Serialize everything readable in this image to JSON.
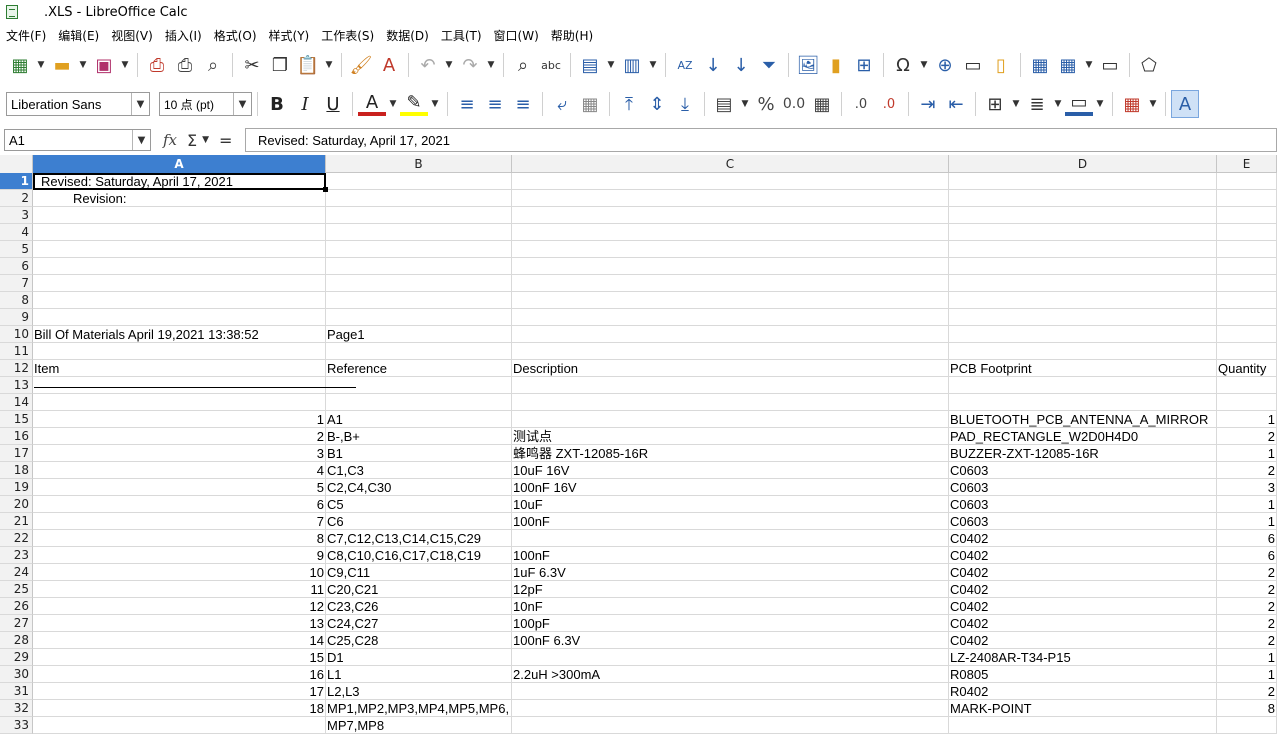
{
  "window": {
    "title": ".XLS - LibreOffice Calc"
  },
  "menu": [
    "文件(F)",
    "编辑(E)",
    "视图(V)",
    "插入(I)",
    "格式(O)",
    "样式(Y)",
    "工作表(S)",
    "数据(D)",
    "工具(T)",
    "窗口(W)",
    "帮助(H)"
  ],
  "toolbar2": {
    "font_name": "Liberation Sans",
    "font_size": "10 点 (pt)"
  },
  "formula": {
    "cell_ref": "A1",
    "fx": "fx",
    "sum": "Σ",
    "equals": "=",
    "content": "Revised: Saturday, April 17, 2021"
  },
  "columns": [
    "A",
    "B",
    "C",
    "D",
    "E"
  ],
  "rows": [
    {
      "n": "1",
      "a": "Revised: Saturday, April 17, 2021",
      "b": "",
      "c": "",
      "d": "",
      "e": ""
    },
    {
      "n": "2",
      "a": "Revision:",
      "b": "",
      "c": "",
      "d": "",
      "e": ""
    },
    {
      "n": "3",
      "a": "",
      "b": "",
      "c": "",
      "d": "",
      "e": ""
    },
    {
      "n": "4",
      "a": "",
      "b": "",
      "c": "",
      "d": "",
      "e": ""
    },
    {
      "n": "5",
      "a": "",
      "b": "",
      "c": "",
      "d": "",
      "e": ""
    },
    {
      "n": "6",
      "a": "",
      "b": "",
      "c": "",
      "d": "",
      "e": ""
    },
    {
      "n": "7",
      "a": "",
      "b": "",
      "c": "",
      "d": "",
      "e": ""
    },
    {
      "n": "8",
      "a": "",
      "b": "",
      "c": "",
      "d": "",
      "e": ""
    },
    {
      "n": "9",
      "a": "",
      "b": "",
      "c": "",
      "d": "",
      "e": ""
    },
    {
      "n": "10",
      "a": "Bill Of Materials          April 19,2021        13:38:52",
      "b": "Page1",
      "c": "",
      "d": "",
      "e": ""
    },
    {
      "n": "11",
      "a": "",
      "b": "",
      "c": "",
      "d": "",
      "e": ""
    },
    {
      "n": "12",
      "a": "Item",
      "b": "Reference",
      "c": "Description",
      "d": "PCB Footprint",
      "e": "Quantity"
    },
    {
      "n": "13",
      "a": "",
      "b": "",
      "c": "",
      "d": "",
      "e": ""
    },
    {
      "n": "14",
      "a": "",
      "b": "",
      "c": "",
      "d": "",
      "e": ""
    },
    {
      "n": "15",
      "a": "1",
      "b": "A1",
      "c": "",
      "d": "BLUETOOTH_PCB_ANTENNA_A_MIRROR",
      "e": "1"
    },
    {
      "n": "16",
      "a": "2",
      "b": "B-,B+",
      "c": "测试点",
      "d": "PAD_RECTANGLE_W2D0H4D0",
      "e": "2"
    },
    {
      "n": "17",
      "a": "3",
      "b": "B1",
      "c": "蜂鸣器 ZXT-12085-16R",
      "d": "BUZZER-ZXT-12085-16R",
      "e": "1"
    },
    {
      "n": "18",
      "a": "4",
      "b": "C1,C3",
      "c": "10uF 16V",
      "d": "C0603",
      "e": "2"
    },
    {
      "n": "19",
      "a": "5",
      "b": "C2,C4,C30",
      "c": "100nF 16V",
      "d": "C0603",
      "e": "3"
    },
    {
      "n": "20",
      "a": "6",
      "b": "C5",
      "c": "10uF",
      "d": "C0603",
      "e": "1"
    },
    {
      "n": "21",
      "a": "7",
      "b": "C6",
      "c": "100nF",
      "d": "C0603",
      "e": "1"
    },
    {
      "n": "22",
      "a": "8",
      "b": "C7,C12,C13,C14,C15,C29",
      "c": "",
      "d": "C0402",
      "e": "6"
    },
    {
      "n": "23",
      "a": "9",
      "b": "C8,C10,C16,C17,C18,C19",
      "c": "100nF",
      "d": "C0402",
      "e": "6"
    },
    {
      "n": "24",
      "a": "10",
      "b": "C9,C11",
      "c": "1uF 6.3V",
      "d": "C0402",
      "e": "2"
    },
    {
      "n": "25",
      "a": "11",
      "b": "C20,C21",
      "c": "12pF",
      "d": "C0402",
      "e": "2"
    },
    {
      "n": "26",
      "a": "12",
      "b": "C23,C26",
      "c": "10nF",
      "d": "C0402",
      "e": "2"
    },
    {
      "n": "27",
      "a": "13",
      "b": "C24,C27",
      "c": "100pF",
      "d": "C0402",
      "e": "2"
    },
    {
      "n": "28",
      "a": "14",
      "b": "C25,C28",
      "c": "100nF 6.3V",
      "d": "C0402",
      "e": "2"
    },
    {
      "n": "29",
      "a": "15",
      "b": "D1",
      "c": "",
      "d": "LZ-2408AR-T34-P15",
      "e": "1"
    },
    {
      "n": "30",
      "a": "16",
      "b": "L1",
      "c": "2.2uH >300mA",
      "d": "R0805",
      "e": "1"
    },
    {
      "n": "31",
      "a": "17",
      "b": "L2,L3",
      "c": "",
      "d": "R0402",
      "e": "2"
    },
    {
      "n": "32",
      "a": "18",
      "b": "MP1,MP2,MP3,MP4,MP5,MP6,",
      "c": "",
      "d": "MARK-POINT",
      "e": "8"
    },
    {
      "n": "33",
      "a": "",
      "b": "MP7,MP8",
      "c": "",
      "d": "",
      "e": ""
    }
  ]
}
